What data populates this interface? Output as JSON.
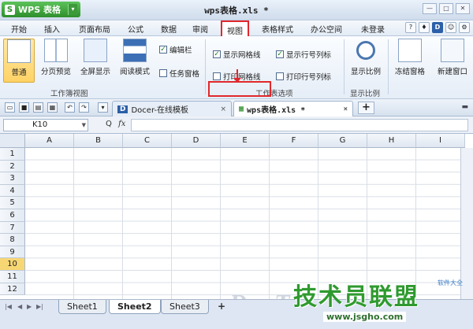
{
  "app": {
    "name": "WPS 表格",
    "logo_letter": "S",
    "menu_arrow": "▾"
  },
  "window": {
    "title": "wps表格.xls *"
  },
  "window_controls": [
    "—",
    "□",
    "✕"
  ],
  "menu": {
    "items": [
      "开始",
      "插入",
      "页面布局",
      "公式",
      "数据",
      "审阅",
      "视图",
      "表格样式",
      "办公空间"
    ],
    "active": "视图",
    "login": "未登录"
  },
  "ribbon": {
    "views": {
      "group_label": "工作簿视图",
      "normal": "普通",
      "page_break": "分页预览",
      "fullscreen": "全屏显示",
      "reading": "阅读模式"
    },
    "show": {
      "formula_bar": "编辑栏",
      "task_pane": "任务窗格"
    },
    "options": {
      "group_label": "工作表选项",
      "show_gridlines": "显示网格线",
      "show_headers": "显示行号列标",
      "print_gridlines": "打印网格线",
      "print_headers": "打印行号列标"
    },
    "zoom": {
      "group_label": "显示比例",
      "label": "显示比例"
    },
    "freeze": "冻结窗格",
    "new_window": "新建窗口"
  },
  "tabs": {
    "docer": "Docer-在线模板",
    "doc": "wps表格.xls *",
    "docer_icon": "D",
    "close": "×",
    "add": "+"
  },
  "formula": {
    "namebox": "K10",
    "fx": "fx",
    "zoom_icon": "Q"
  },
  "columns": [
    "A",
    "B",
    "C",
    "D",
    "E",
    "F",
    "G",
    "H",
    "I"
  ],
  "rows": [
    "1",
    "2",
    "3",
    "4",
    "5",
    "6",
    "7",
    "8",
    "9",
    "10",
    "11",
    "12"
  ],
  "selected_row": "10",
  "sheets": [
    "Sheet1",
    "Sheet2",
    "Sheet3"
  ],
  "active_sheet": "Sheet2",
  "watermark": "www.DuoTe.com",
  "brand": {
    "name": "技术员联盟",
    "url": "www.jsgho.com",
    "small": "软件大全"
  },
  "colors": {
    "accent_green": "#2e8f2c",
    "highlight_red": "#e0282c",
    "selected_row": "#f7d774"
  }
}
